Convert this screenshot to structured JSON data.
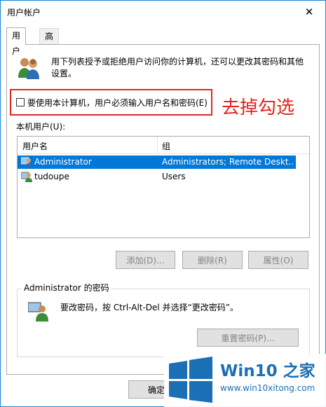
{
  "window": {
    "title": "用户帐户",
    "close_glyph": "✕"
  },
  "tabs": [
    {
      "label": "用户"
    },
    {
      "label": "高级"
    }
  ],
  "description": "用下列表授予或拒绝用户访问你的计算机，还可以更改其密码和其他设置。",
  "require_password": {
    "label": "要使用本计算机，用户必须输入用户名和密码(E)",
    "checked": false
  },
  "annotation": "去掉勾选",
  "users_list": {
    "label": "本机用户(U):",
    "columns": [
      "用户名",
      "组"
    ],
    "rows": [
      {
        "name": "Administrator",
        "group": "Administrators; Remote Deskt...",
        "selected": true
      },
      {
        "name": "tudoupe",
        "group": "Users",
        "selected": false
      }
    ]
  },
  "buttons": {
    "add": "添加(D)...",
    "remove": "删除(R)",
    "properties": "属性(O)"
  },
  "password_group": {
    "title": "Administrator 的密码",
    "text": "要改密码，按 Ctrl-Alt-Del 并选择“更改密码”。",
    "reset_button": "重置密码(P)..."
  },
  "footer": {
    "ok_button": "确定"
  },
  "watermark": {
    "brand": "Win10 之家",
    "url": "www.win10xitong.com"
  },
  "colors": {
    "accent": "#0078d7",
    "annotation": "#e0261f",
    "brand": "#1a6fb5"
  }
}
